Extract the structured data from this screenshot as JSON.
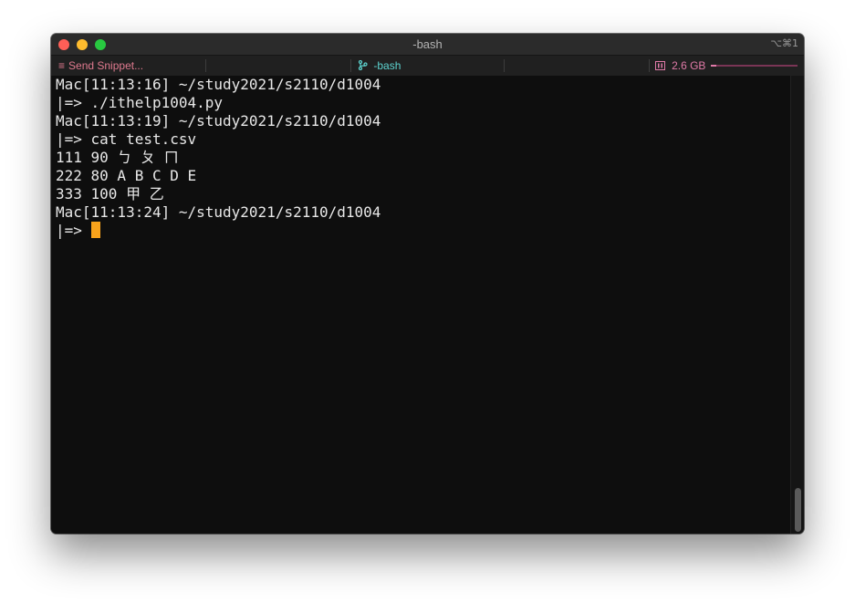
{
  "window": {
    "title": "-bash",
    "shortcut": "⌥⌘1"
  },
  "tabbar": {
    "snippet_icon": "≡",
    "snippet_label": "Send Snippet...",
    "bash_icon": "branch-icon",
    "bash_label": "-bash",
    "memory_icon": "memory-icon",
    "memory_label": "2.6 GB",
    "memory_usage": 0.06,
    "colors": {
      "snippet": "#e07a8f",
      "bash": "#5dd4d0",
      "memory": "#e07aa8"
    }
  },
  "terminal": {
    "lines": [
      "Mac[11:13:16] ~/study2021/s2110/d1004",
      "|=> ./ithelp1004.py",
      "Mac[11:13:19] ~/study2021/s2110/d1004",
      "|=> cat test.csv",
      "111 90 ㄅ ㄆ ㄇ",
      "222 80 A B C D E",
      "333 100 甲 乙",
      "Mac[11:13:24] ~/study2021/s2110/d1004",
      "|=> "
    ],
    "cursor_color": "#f9a31b"
  }
}
